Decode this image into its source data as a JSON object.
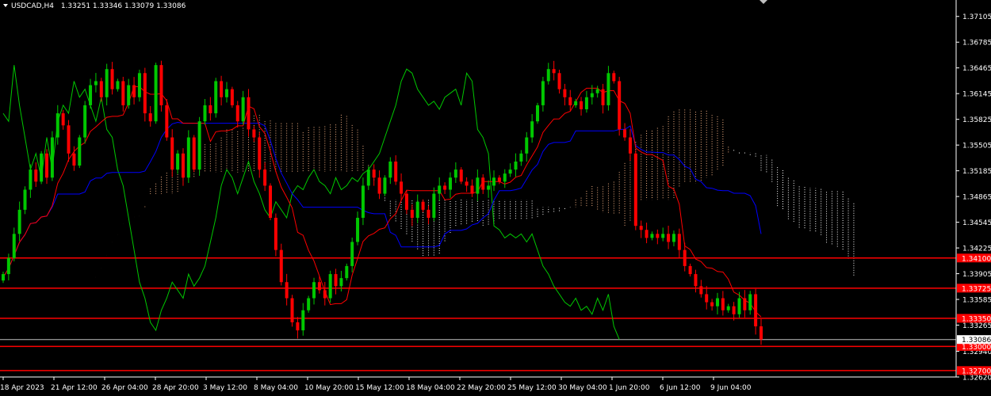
{
  "header": {
    "symbol_timeframe": "USDCAD,H4",
    "ohlc": "1.33251 1.33346 1.33079 1.33086"
  },
  "colors": {
    "background": "#000000",
    "axis": "#ffffff",
    "bull_candle": "#00c800",
    "bear_candle": "#ff0000",
    "tenkan": "#ff0000",
    "kijun": "#0000ff",
    "chikou": "#00c800",
    "kumo_a": "#f4b183",
    "kumo_b": "#ffffff",
    "level_line": "#ff0000",
    "level_tag_bg": "#ff0000",
    "price_tag_bg": "#ffffff",
    "price_tag_text": "#000000"
  },
  "chart_data": {
    "type": "candlestick",
    "symbol": "USDCAD",
    "timeframe": "H4",
    "ylim": [
      1.3262,
      1.3727
    ],
    "y_ticks": [
      "1.37105",
      "1.36785",
      "1.36465",
      "1.36145",
      "1.35825",
      "1.35505",
      "1.35185",
      "1.34865",
      "1.34545",
      "1.34225",
      "1.33905",
      "1.33585",
      "1.33265",
      "1.32940",
      "1.32620"
    ],
    "x_ticks": [
      "18 Apr 2023",
      "21 Apr 12:00",
      "26 Apr 04:00",
      "28 Apr 20:00",
      "3 May 12:00",
      "8 May 04:00",
      "10 May 20:00",
      "15 May 12:00",
      "18 May 04:00",
      "22 May 20:00",
      "25 May 12:00",
      "30 May 04:00",
      "1 Jun 20:00",
      "6 Jun 12:00",
      "9 Jun 04:00"
    ],
    "levels": [
      "1.34100",
      "1.33725",
      "1.33350",
      "1.33000",
      "1.32700"
    ],
    "current_price": "1.33086",
    "candle_count": 140,
    "cloud_extension": 17,
    "closes": [
      1.339,
      1.341,
      1.344,
      1.347,
      1.3495,
      1.352,
      1.3505,
      1.354,
      1.351,
      1.356,
      1.359,
      1.3575,
      1.354,
      1.3525,
      1.356,
      1.36,
      1.3625,
      1.363,
      1.361,
      1.3645,
      1.362,
      1.363,
      1.36,
      1.3625,
      1.361,
      1.364,
      1.359,
      1.358,
      1.365,
      1.36,
      1.356,
      1.352,
      1.354,
      1.351,
      1.356,
      1.352,
      1.358,
      1.36,
      1.359,
      1.363,
      1.361,
      1.362,
      1.36,
      1.358,
      1.361,
      1.357,
      1.356,
      1.352,
      1.35,
      1.346,
      1.342,
      1.338,
      1.336,
      1.333,
      1.332,
      1.3345,
      1.336,
      1.338,
      1.337,
      1.336,
      1.339,
      1.3375,
      1.3385,
      1.34,
      1.343,
      1.346,
      1.35,
      1.352,
      1.351,
      1.349,
      1.351,
      1.353,
      1.3505,
      1.349,
      1.347,
      1.346,
      1.348,
      1.347,
      1.346,
      1.349,
      1.35,
      1.3495,
      1.351,
      1.352,
      1.3505,
      1.35,
      1.349,
      1.351,
      1.3495,
      1.35,
      1.351,
      1.3505,
      1.3515,
      1.352,
      1.353,
      1.354,
      1.356,
      1.358,
      1.36,
      1.363,
      1.3645,
      1.364,
      1.362,
      1.361,
      1.36,
      1.3605,
      1.3595,
      1.361,
      1.3615,
      1.362,
      1.36,
      1.364,
      1.363,
      1.357,
      1.356,
      1.354,
      1.345,
      1.3445,
      1.3435,
      1.344,
      1.3435,
      1.344,
      1.343,
      1.344,
      1.342,
      1.34,
      1.339,
      1.3375,
      1.3365,
      1.3355,
      1.335,
      1.336,
      1.3345,
      1.335,
      1.334,
      1.336,
      1.3345,
      1.3365,
      1.3325,
      1.33086
    ]
  }
}
